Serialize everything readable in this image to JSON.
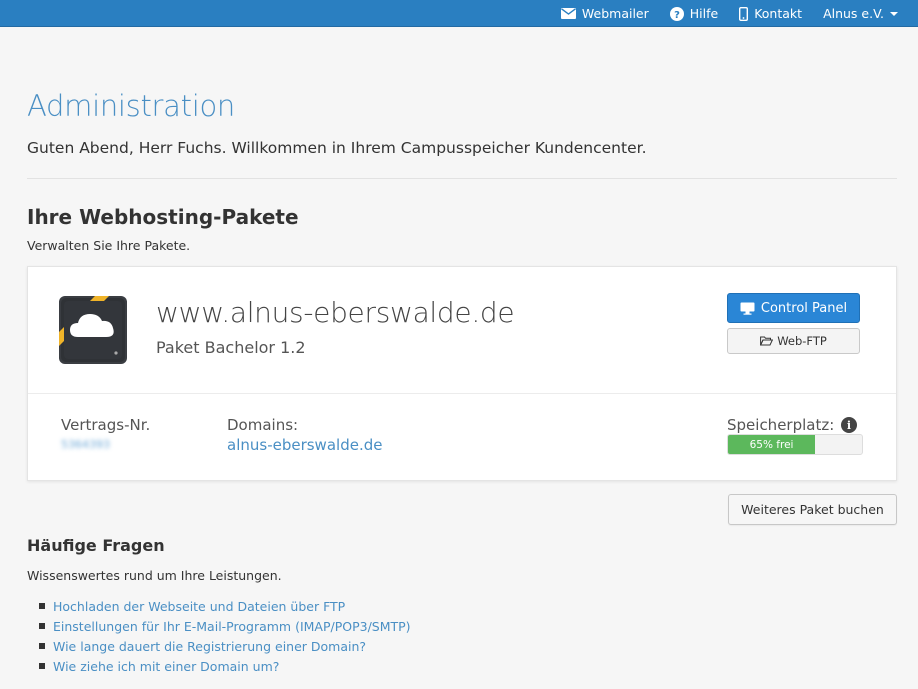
{
  "topbar": {
    "items": [
      {
        "label": "Webmailer",
        "icon": "envelope-icon"
      },
      {
        "label": "Hilfe",
        "icon": "question-circle-icon"
      },
      {
        "label": "Kontakt",
        "icon": "mobile-phone-icon"
      },
      {
        "label": "Alnus e.V.",
        "icon": "chevron-down-icon"
      }
    ],
    "color": "#2a7fc1"
  },
  "header": {
    "title": "Administration",
    "greeting": "Guten Abend, Herr Fuchs. Willkommen in Ihrem Campusspeicher Kundencenter."
  },
  "packages": {
    "title": "Ihre Webhosting-Pakete",
    "subtitle": "Verwalten Sie Ihre Pakete.",
    "items": [
      {
        "domain": "www.alnus-eberswalde.de",
        "plan": "Paket Bachelor 1.2",
        "control_panel_label": "Control Panel",
        "webftp_label": "Web-FTP",
        "contract_label": "Vertrags-Nr.",
        "contract_value": "5364393",
        "domains_label": "Domains:",
        "domains": [
          "alnus-eberswalde.de"
        ],
        "storage_label": "Speicherplatz:",
        "storage_free_percent": 65,
        "storage_text": "65% frei"
      }
    ],
    "buy_button_label": "Weiteres Paket buchen"
  },
  "faq": {
    "title": "Häufige Fragen",
    "subtitle": "Wissenswertes rund um Ihre Leistungen.",
    "links": [
      "Hochladen der Webseite und Dateien über FTP",
      "Einstellungen für Ihr E-Mail-Programm (IMAP/POP3/SMTP)",
      "Wie lange dauert die Registrierung einer Domain?",
      "Wie ziehe ich mit einer Domain um?"
    ]
  },
  "colors": {
    "accent": "#4a8fc4",
    "primary_button": "#2a86d6",
    "progress": "#5cb85c"
  }
}
